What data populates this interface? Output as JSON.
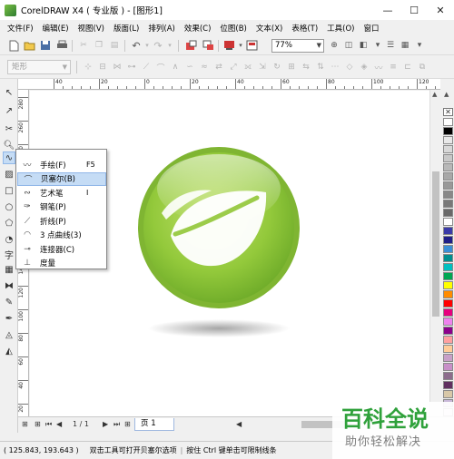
{
  "window": {
    "title": "CorelDRAW X4 ( 专业版 ) - [图形1]"
  },
  "menu": [
    "文件(F)",
    "编辑(E)",
    "视图(V)",
    "版面(L)",
    "排列(A)",
    "效果(C)",
    "位图(B)",
    "文本(X)",
    "表格(T)",
    "工具(O)",
    "窗口"
  ],
  "toolbar": {
    "zoom": "77%"
  },
  "property_bar": {
    "shape_select": "矩形"
  },
  "ruler": {
    "top_labels": [
      "40",
      "20",
      "0",
      "20",
      "40",
      "60",
      "80",
      "100",
      "120",
      "140",
      "160"
    ],
    "left_labels": [
      "280",
      "260",
      "240",
      "220",
      "200",
      "180",
      "160",
      "140",
      "120",
      "100",
      "80",
      "60",
      "40",
      "20"
    ]
  },
  "flyout": {
    "items": [
      {
        "label": "手绘(F)",
        "shortcut": "F5",
        "icon": "freehand-icon"
      },
      {
        "label": "贝塞尔(B)",
        "shortcut": "",
        "icon": "bezier-icon",
        "selected": true
      },
      {
        "label": "艺术笔",
        "shortcut": "I",
        "icon": "artistic-media-icon"
      },
      {
        "label": "钢笔(P)",
        "shortcut": "",
        "icon": "pen-icon"
      },
      {
        "label": "折线(P)",
        "shortcut": "",
        "icon": "polyline-icon"
      },
      {
        "label": "3 点曲线(3)",
        "shortcut": "",
        "icon": "three-point-curve-icon"
      },
      {
        "label": "连接器(C)",
        "shortcut": "",
        "icon": "connector-icon"
      },
      {
        "label": "度量",
        "shortcut": "",
        "icon": "dimension-icon"
      }
    ]
  },
  "pagenav": {
    "count": "1 / 1",
    "page_tab": "页 1"
  },
  "status": {
    "coords": "( 125.843, 193.643 )",
    "hint1": "双击工具可打开贝塞尔选项",
    "hint2": "按住 Ctrl 键单击可限制线条"
  },
  "palette": [
    "#ffffff",
    "#000000",
    "#e8e8e8",
    "#d8d8d8",
    "#c8c8c8",
    "#b8b8b8",
    "#a8a8a8",
    "#989898",
    "#888888",
    "#787878",
    "#686868",
    "#ffffff",
    "#3a3aa8",
    "#1f1f88",
    "#3a8fd6",
    "#008f8f",
    "#00c0c0",
    "#00a651",
    "#ffff00",
    "#ff8c00",
    "#ff0000",
    "#e6007e",
    "#ee82ee",
    "#8b008b",
    "#ffa0a0",
    "#ffcc99",
    "#c8a0c8",
    "#c890c8",
    "#8c6c8c",
    "#603060",
    "#d8c8a8",
    "#c8b8d8",
    "#f0e0f0"
  ],
  "watermark": {
    "logo_text": "百科全说",
    "tagline": "助你轻松解决"
  }
}
